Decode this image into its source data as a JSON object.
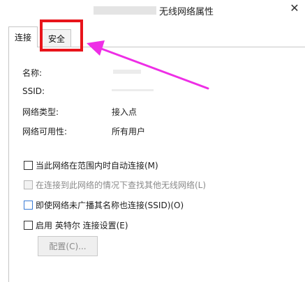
{
  "window": {
    "title_suffix": "无线网络属性",
    "close_glyph": "✕"
  },
  "tabs": [
    {
      "label": "连接",
      "active": true
    },
    {
      "label": "安全",
      "active": false
    }
  ],
  "fields": {
    "name": {
      "label": "名称:"
    },
    "ssid": {
      "label": "SSID:"
    },
    "network_type": {
      "label": "网络类型:",
      "value": "接入点"
    },
    "availability": {
      "label": "网络可用性:",
      "value": "所有用户"
    }
  },
  "options": [
    {
      "label": "当此网络在范围内时自动连接(M)",
      "checked": false,
      "enabled": true
    },
    {
      "label": "在连接到此网络的情况下查找其他无线网络(L)",
      "checked": false,
      "enabled": false
    },
    {
      "label": "即使网络未广播其名称也连接(SSID)(O)",
      "checked": false,
      "enabled": true
    },
    {
      "label": "启用 英特尔 连接设置(E)",
      "checked": false,
      "enabled": true
    }
  ],
  "buttons": {
    "configure": "配置(C)..."
  },
  "annotation": {
    "highlight_color": "#e8141b",
    "arrow_color": "#ee2ee6"
  }
}
